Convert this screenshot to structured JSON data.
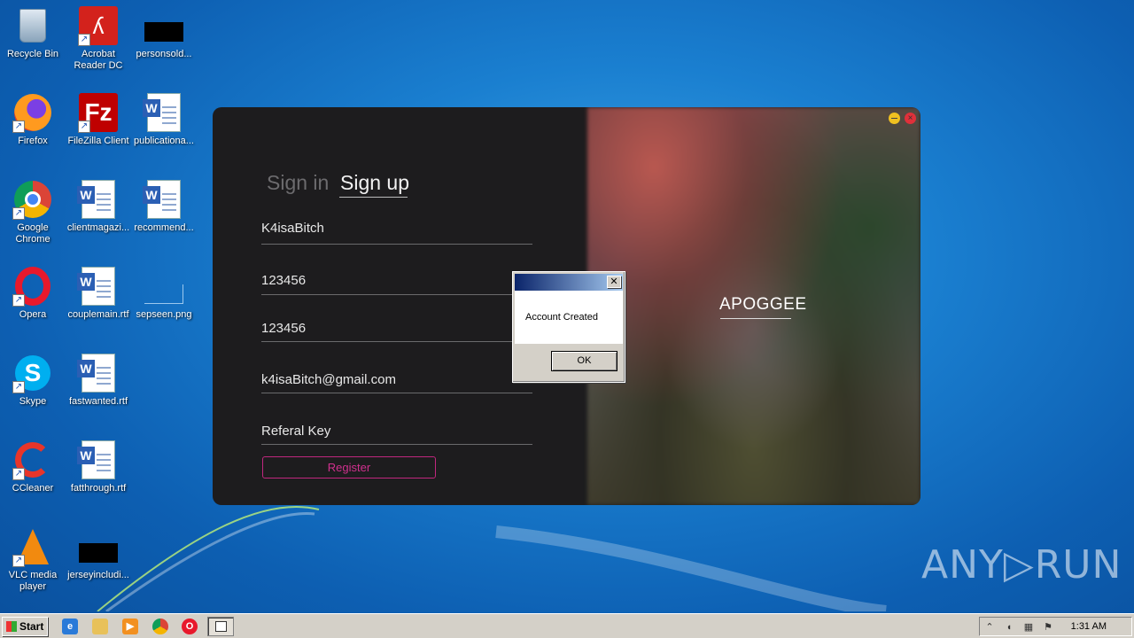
{
  "desktop": {
    "icons": [
      {
        "label": "Recycle Bin"
      },
      {
        "label": "Acrobat Reader DC"
      },
      {
        "label": "personsold..."
      },
      {
        "label": "Firefox"
      },
      {
        "label": "FileZilla Client"
      },
      {
        "label": "publicationa..."
      },
      {
        "label": "Google Chrome"
      },
      {
        "label": "clientmagazi..."
      },
      {
        "label": "recommend..."
      },
      {
        "label": "Opera"
      },
      {
        "label": "couplemain.rtf"
      },
      {
        "label": "sepseen.png"
      },
      {
        "label": "Skype"
      },
      {
        "label": "fastwanted.rtf"
      },
      {
        "label": "CCleaner"
      },
      {
        "label": "fatthrough.rtf"
      },
      {
        "label": "VLC media player"
      },
      {
        "label": "jerseyincludi..."
      }
    ]
  },
  "app": {
    "tabs": {
      "signin": "Sign in",
      "signup": "Sign up"
    },
    "fields": {
      "username": "K4isaBitch",
      "password": "123456",
      "confirm_password": "123456",
      "email": "k4isaBitch@gmail.com",
      "referral": "Referal Key"
    },
    "register_label": "Register",
    "brand": "APOGGEE",
    "close_glyph": "×",
    "colors": {
      "accent": "#c0277e",
      "panel": "#1d1c1e"
    }
  },
  "dialog": {
    "title": "",
    "message": "Account Created",
    "ok_label": "OK",
    "close_glyph": "✕"
  },
  "watermark": "ANY▷RUN",
  "taskbar": {
    "start_label": "Start",
    "clock": "1:31 AM"
  }
}
